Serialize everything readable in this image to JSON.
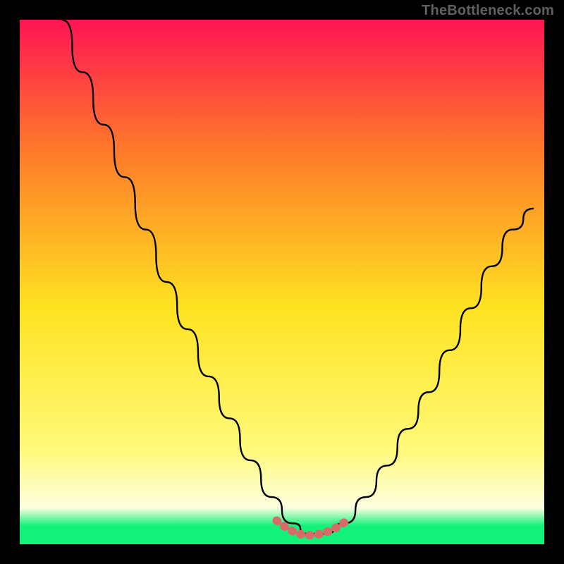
{
  "watermark": "TheBottleneck.com",
  "colors": {
    "top": "#ff1454",
    "mid_upper": "#ff7a2a",
    "mid": "#ffe321",
    "bottom_yellow": "#fff97a",
    "bottom_cream": "#feffe0",
    "bottom_green": "#12f17a",
    "curve": "#000000",
    "valley_marker": "#d86a6a"
  },
  "chart_data": {
    "type": "line",
    "title": "",
    "xlabel": "",
    "ylabel": "",
    "xlim": [
      0,
      100
    ],
    "ylim": [
      0,
      100
    ],
    "series": [
      {
        "name": "bottleneck-curve",
        "x": [
          8,
          12,
          16,
          20,
          24,
          28,
          32,
          36,
          40,
          44,
          48,
          52,
          55,
          58,
          62,
          66,
          70,
          74,
          78,
          82,
          86,
          90,
          94,
          98
        ],
        "y": [
          100,
          90,
          80,
          70,
          60,
          50,
          41,
          32,
          24,
          16,
          9,
          4,
          2,
          2,
          4,
          9,
          15,
          22,
          29,
          37,
          45,
          53,
          60,
          64
        ]
      },
      {
        "name": "valley-marker",
        "x": [
          49,
          51,
          53,
          55,
          57,
          59,
          61,
          63
        ],
        "y": [
          4.5,
          3.0,
          2.0,
          1.7,
          1.9,
          2.5,
          3.5,
          5.0
        ]
      }
    ],
    "valley_range_x": [
      49,
      63
    ],
    "gradient_stops": [
      {
        "offset": 0.0,
        "color": "#ff1454"
      },
      {
        "offset": 0.25,
        "color": "#ff7a2a"
      },
      {
        "offset": 0.55,
        "color": "#ffe321"
      },
      {
        "offset": 0.82,
        "color": "#fff97a"
      },
      {
        "offset": 0.93,
        "color": "#feffe0"
      },
      {
        "offset": 0.965,
        "color": "#12f17a"
      },
      {
        "offset": 1.0,
        "color": "#12f17a"
      }
    ]
  }
}
